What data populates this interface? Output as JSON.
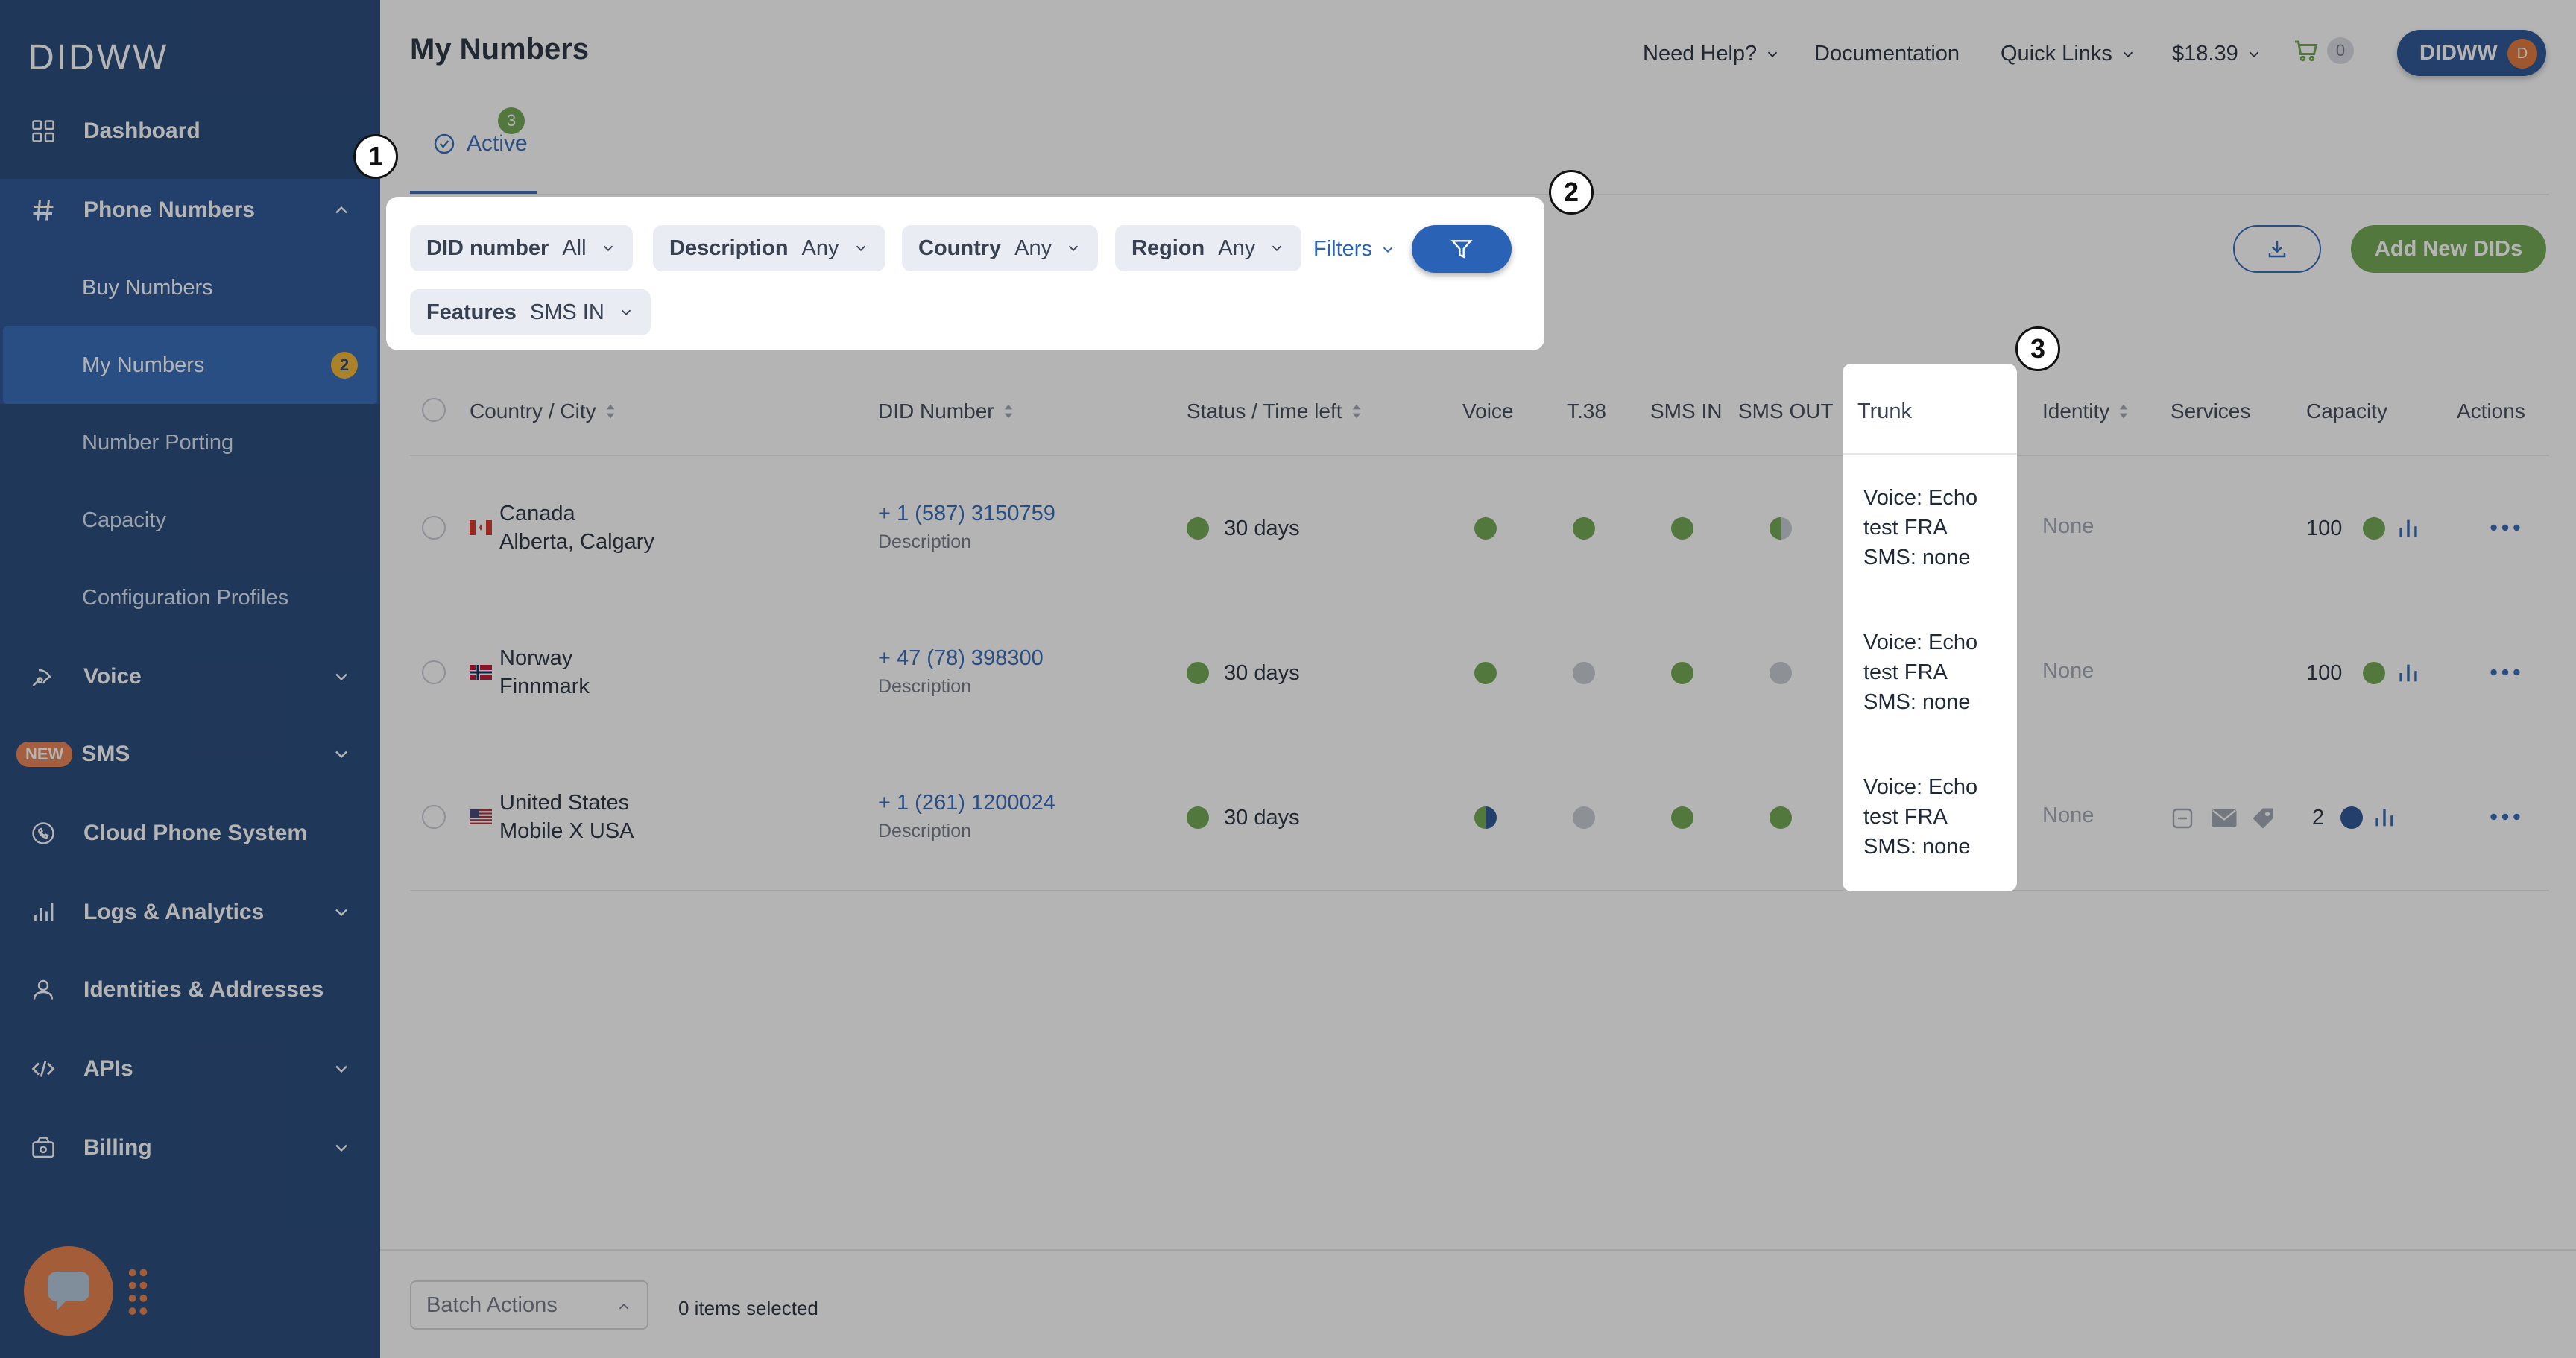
{
  "sidebar": {
    "logo": "DIDWW",
    "items": [
      {
        "label": "Dashboard"
      },
      {
        "label": "Phone Numbers"
      },
      {
        "label": "Buy Numbers"
      },
      {
        "label": "My Numbers",
        "badge": "2"
      },
      {
        "label": "Number Porting"
      },
      {
        "label": "Capacity"
      },
      {
        "label": "Configuration Profiles"
      },
      {
        "label": "Voice"
      },
      {
        "label": "SMS",
        "badge": "NEW"
      },
      {
        "label": "Cloud Phone System"
      },
      {
        "label": "Logs & Analytics"
      },
      {
        "label": "Identities & Addresses"
      },
      {
        "label": "APIs"
      },
      {
        "label": "Billing"
      }
    ]
  },
  "header": {
    "title": "My Numbers",
    "need_help": "Need Help?",
    "documentation": "Documentation",
    "quick_links": "Quick Links",
    "balance": "$18.39",
    "cart_count": "0",
    "user": "DIDWW",
    "user_initial": "D"
  },
  "tabs": {
    "active_label": "Active",
    "active_count": "3"
  },
  "filters": {
    "did_number": {
      "label": "DID number",
      "value": "All"
    },
    "description": {
      "label": "Description",
      "value": "Any"
    },
    "country": {
      "label": "Country",
      "value": "Any"
    },
    "region": {
      "label": "Region",
      "value": "Any"
    },
    "features": {
      "label": "Features",
      "value": "SMS IN"
    },
    "filters_link": "Filters"
  },
  "actions": {
    "add_new": "Add New DIDs"
  },
  "table": {
    "columns": {
      "country_city": "Country / City",
      "did_number": "DID Number",
      "status": "Status / Time left",
      "voice": "Voice",
      "t38": "T.38",
      "sms_in": "SMS IN",
      "sms_out": "SMS OUT",
      "trunk": "Trunk",
      "identity": "Identity",
      "services": "Services",
      "capacity": "Capacity",
      "actions": "Actions"
    },
    "rows": [
      {
        "country": "Canada",
        "city": "Alberta, Calgary",
        "number": "+ 1 (587) 3150759",
        "desc": "Description",
        "time_left": "30 days",
        "trunk_1": "Voice: Echo",
        "trunk_2": "test FRA",
        "trunk_3": "SMS: none",
        "identity": "None",
        "capacity": "100"
      },
      {
        "country": "Norway",
        "city": "Finnmark",
        "number": "+ 47 (78) 398300",
        "desc": "Description",
        "time_left": "30 days",
        "trunk_1": "Voice: Echo",
        "trunk_2": "test FRA",
        "trunk_3": "SMS: none",
        "identity": "None",
        "capacity": "100"
      },
      {
        "country": "United States",
        "city": "Mobile X USA",
        "number": "+ 1 (261) 1200024",
        "desc": "Description",
        "time_left": "30 days",
        "trunk_1": "Voice: Echo",
        "trunk_2": "test FRA",
        "trunk_3": "SMS: none",
        "identity": "None",
        "capacity": "2"
      }
    ]
  },
  "footer": {
    "batch_actions": "Batch Actions",
    "items_selected": "0 items selected"
  },
  "callouts": [
    "1",
    "2",
    "3"
  ],
  "colors": {
    "sidebar": "#1b3f74",
    "accent": "#2a63b5",
    "green": "#6ba34a"
  }
}
